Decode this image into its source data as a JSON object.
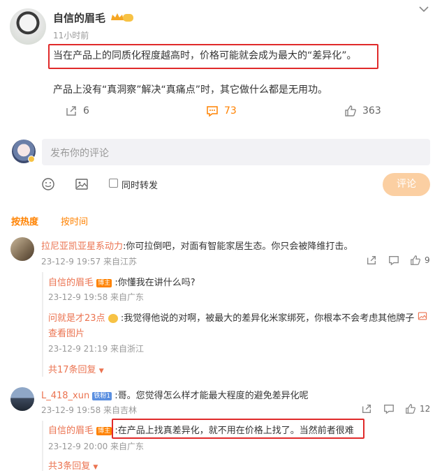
{
  "post": {
    "author": "自信的眉毛",
    "time": "11小时前",
    "line1": "当在产品上的同质化程度越高时，价格可能就会成为最大的“差异化”。",
    "line2": "产品上没有“真洞察”解决“真痛点”时，其它做什么都是无用功。",
    "shares": "6",
    "comments": "73",
    "likes": "363"
  },
  "composer": {
    "placeholder": "发布你的评论",
    "repost_label": "同时转发",
    "submit_label": "评论"
  },
  "sort": {
    "hot": "按热度",
    "time": "按时间"
  },
  "comments": [
    {
      "user": "拉尼亚凯亚星系动力",
      "text": ":你可拉倒吧，对面有智能家居生态。你只会被降维打击。",
      "meta": "23-12-9 19:57 来自江苏",
      "likes": "9",
      "replies": [
        {
          "user": "自信的眉毛",
          "badge": "博主",
          "text": ":你懂我在讲什么吗?",
          "meta": "23-12-9 19:58 来自广东"
        },
        {
          "user": "问就是才23点",
          "text": ":我觉得他说的对啊，被最大的差异化米家绑死，你根本不会考虑其他牌子",
          "extra": "查看图片",
          "meta": "23-12-9 21:19 来自浙江"
        }
      ],
      "more": "共17条回复"
    },
    {
      "user": "L_418_xun",
      "badge": "铁粉1",
      "text": ":哥。您觉得怎么样才能最大程度的避免差异化呢",
      "meta": "23-12-9 19:58 来自吉林",
      "likes": "12",
      "replies": [
        {
          "user": "自信的眉毛",
          "badge": "博主",
          "text": ":在产品上找真差异化，就不用在价格上找了。当然前者很难",
          "meta": "23-12-9 20:00 来自广东"
        }
      ],
      "more": "共3条回复"
    }
  ]
}
